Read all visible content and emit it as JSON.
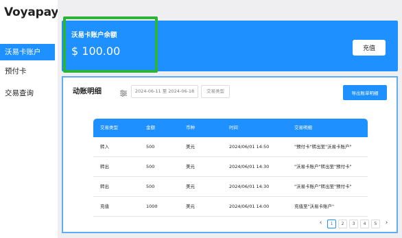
{
  "app": {
    "title": "Voyapay"
  },
  "sidebar": {
    "items": [
      {
        "label": "沃易卡账户",
        "active": true
      },
      {
        "label": "预付卡",
        "active": false
      },
      {
        "label": "交易查询",
        "active": false
      }
    ]
  },
  "balance": {
    "label": "沃易卡账户余额",
    "value": "$ 100.00",
    "recharge_label": "充值"
  },
  "details": {
    "title": "动账明细",
    "date_range": "2024-06-11 至 2024-06-18",
    "type_placeholder": "交易类型",
    "export_label": "导出账单明细",
    "columns": [
      "交易类型",
      "金额",
      "币种",
      "时间",
      "交易明细"
    ],
    "rows": [
      [
        "转入",
        "500",
        "美元",
        "2024/06/01 14:50",
        "\"预付卡\"转出至\"沃易卡账户\""
      ],
      [
        "转出",
        "500",
        "美元",
        "2024/06/01 14:30",
        "\"沃易卡账户\"转出至\"预付卡\""
      ],
      [
        "转出",
        "500",
        "美元",
        "2024/06/01 14:30",
        "\"沃易卡账户\"转出至\"预付卡\""
      ],
      [
        "充值",
        "1000",
        "美元",
        "2024/06/01 14:00",
        "充值至\"沃易卡账户\""
      ]
    ]
  },
  "pagination": {
    "prev": "‹",
    "pages": [
      "1",
      "2",
      "3",
      "4",
      "5"
    ],
    "current": "1",
    "next": "›"
  },
  "colors": {
    "accent": "#1e90ff",
    "highlight": "#2eb33a",
    "background": "#efeff2"
  }
}
